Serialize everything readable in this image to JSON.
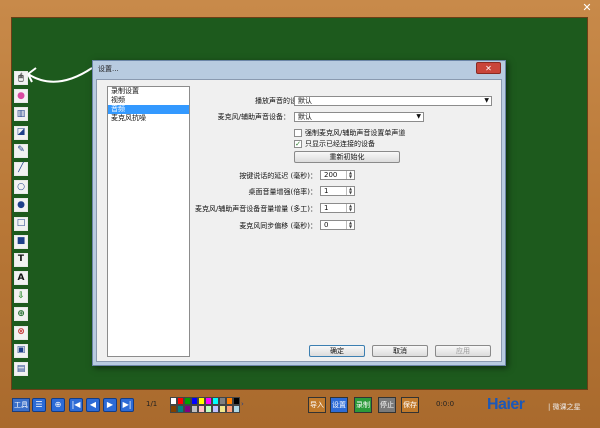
{
  "window": {
    "close_glyph": "✕"
  },
  "left_tools": [
    {
      "name": "mouse-icon",
      "glyph": "🖱",
      "color": "#555"
    },
    {
      "name": "color-wheel-icon",
      "glyph": "●",
      "color": "#d94aa0"
    },
    {
      "name": "pen-width-icon",
      "glyph": "▥",
      "color": "#1e3f8a"
    },
    {
      "name": "background-icon",
      "glyph": "◪",
      "color": "#1e3f8a"
    },
    {
      "name": "eraser-icon",
      "glyph": "✎",
      "color": "#1e3f8a"
    },
    {
      "name": "line-icon",
      "glyph": "╱",
      "color": "#1e3f8a"
    },
    {
      "name": "circle-outline-icon",
      "glyph": "○",
      "color": "#1e3f8a"
    },
    {
      "name": "circle-filled-icon",
      "glyph": "●",
      "color": "#1e3f8a"
    },
    {
      "name": "rect-outline-icon",
      "glyph": "□",
      "color": "#1e3f8a"
    },
    {
      "name": "rect-filled-icon",
      "glyph": "■",
      "color": "#1e3f8a"
    },
    {
      "name": "text-icon",
      "glyph": "T",
      "color": "#111"
    },
    {
      "name": "text-style-icon",
      "glyph": "A",
      "color": "#111"
    },
    {
      "name": "import-icon",
      "glyph": "⇩",
      "color": "#2a8a2a"
    },
    {
      "name": "zoom-icon",
      "glyph": "⊕",
      "color": "#1e6a2a"
    },
    {
      "name": "clear-icon",
      "glyph": "⊗",
      "color": "#c83a3a"
    },
    {
      "name": "save-icon",
      "glyph": "▣",
      "color": "#1e3f8a"
    },
    {
      "name": "screen-icon",
      "glyph": "▤",
      "color": "#1e3f8a"
    }
  ],
  "dialog": {
    "title": "设置...",
    "close_glyph": "✕",
    "nav": [
      {
        "label": "录制设置",
        "selected": false
      },
      {
        "label": "视频",
        "selected": false
      },
      {
        "label": "音频",
        "selected": true
      },
      {
        "label": "麦克风抗噪",
        "selected": false
      }
    ],
    "playback_label": "播放声音的设备：",
    "playback_value": "默认",
    "mic_label": "麦克风/辅助声音设备：",
    "mic_value": "默认",
    "mono_label": "强制麦克风/辅助声音设置单声道",
    "mono_checked": "",
    "show_connected_label": "只显示已经连接的设备",
    "show_connected_checked": "✓",
    "reinit_button": "重新初始化",
    "ptt_label": "按键说话的延迟 (毫秒)：",
    "ptt_value": "200",
    "desktop_gain_label": "桌面音量增强(倍率)：",
    "desktop_gain_value": "1",
    "mic_gain_label": "麦克风/辅助声音设备音量增量 (多工)：",
    "mic_gain_value": "1",
    "mic_sync_label": "麦克风同步偏移 (毫秒)：",
    "mic_sync_value": "0",
    "ok_button": "确定",
    "cancel_button": "取消",
    "apply_button": "应用"
  },
  "bottom": {
    "tools_label": "工具",
    "page": "1/1",
    "palette": [
      "#ffffff",
      "#ff0000",
      "#00a000",
      "#0000ff",
      "#ffff00",
      "#ff00ff",
      "#00ffff",
      "#808080",
      "#ff8000",
      "#000000",
      "#804000",
      "#008080",
      "#800080",
      "#c0c0c0",
      "#ffc0c0",
      "#c0ffc0",
      "#c0c0ff",
      "#f0e68c",
      "#ffa07a",
      "#add8e6"
    ],
    "import_label": "导入",
    "settings_label": "设置",
    "record_label": "录制",
    "stop_label": "停止",
    "save_label": "保存",
    "time": "0:0:0",
    "brand": "Haier",
    "brand_sub": "| 微课之星"
  }
}
